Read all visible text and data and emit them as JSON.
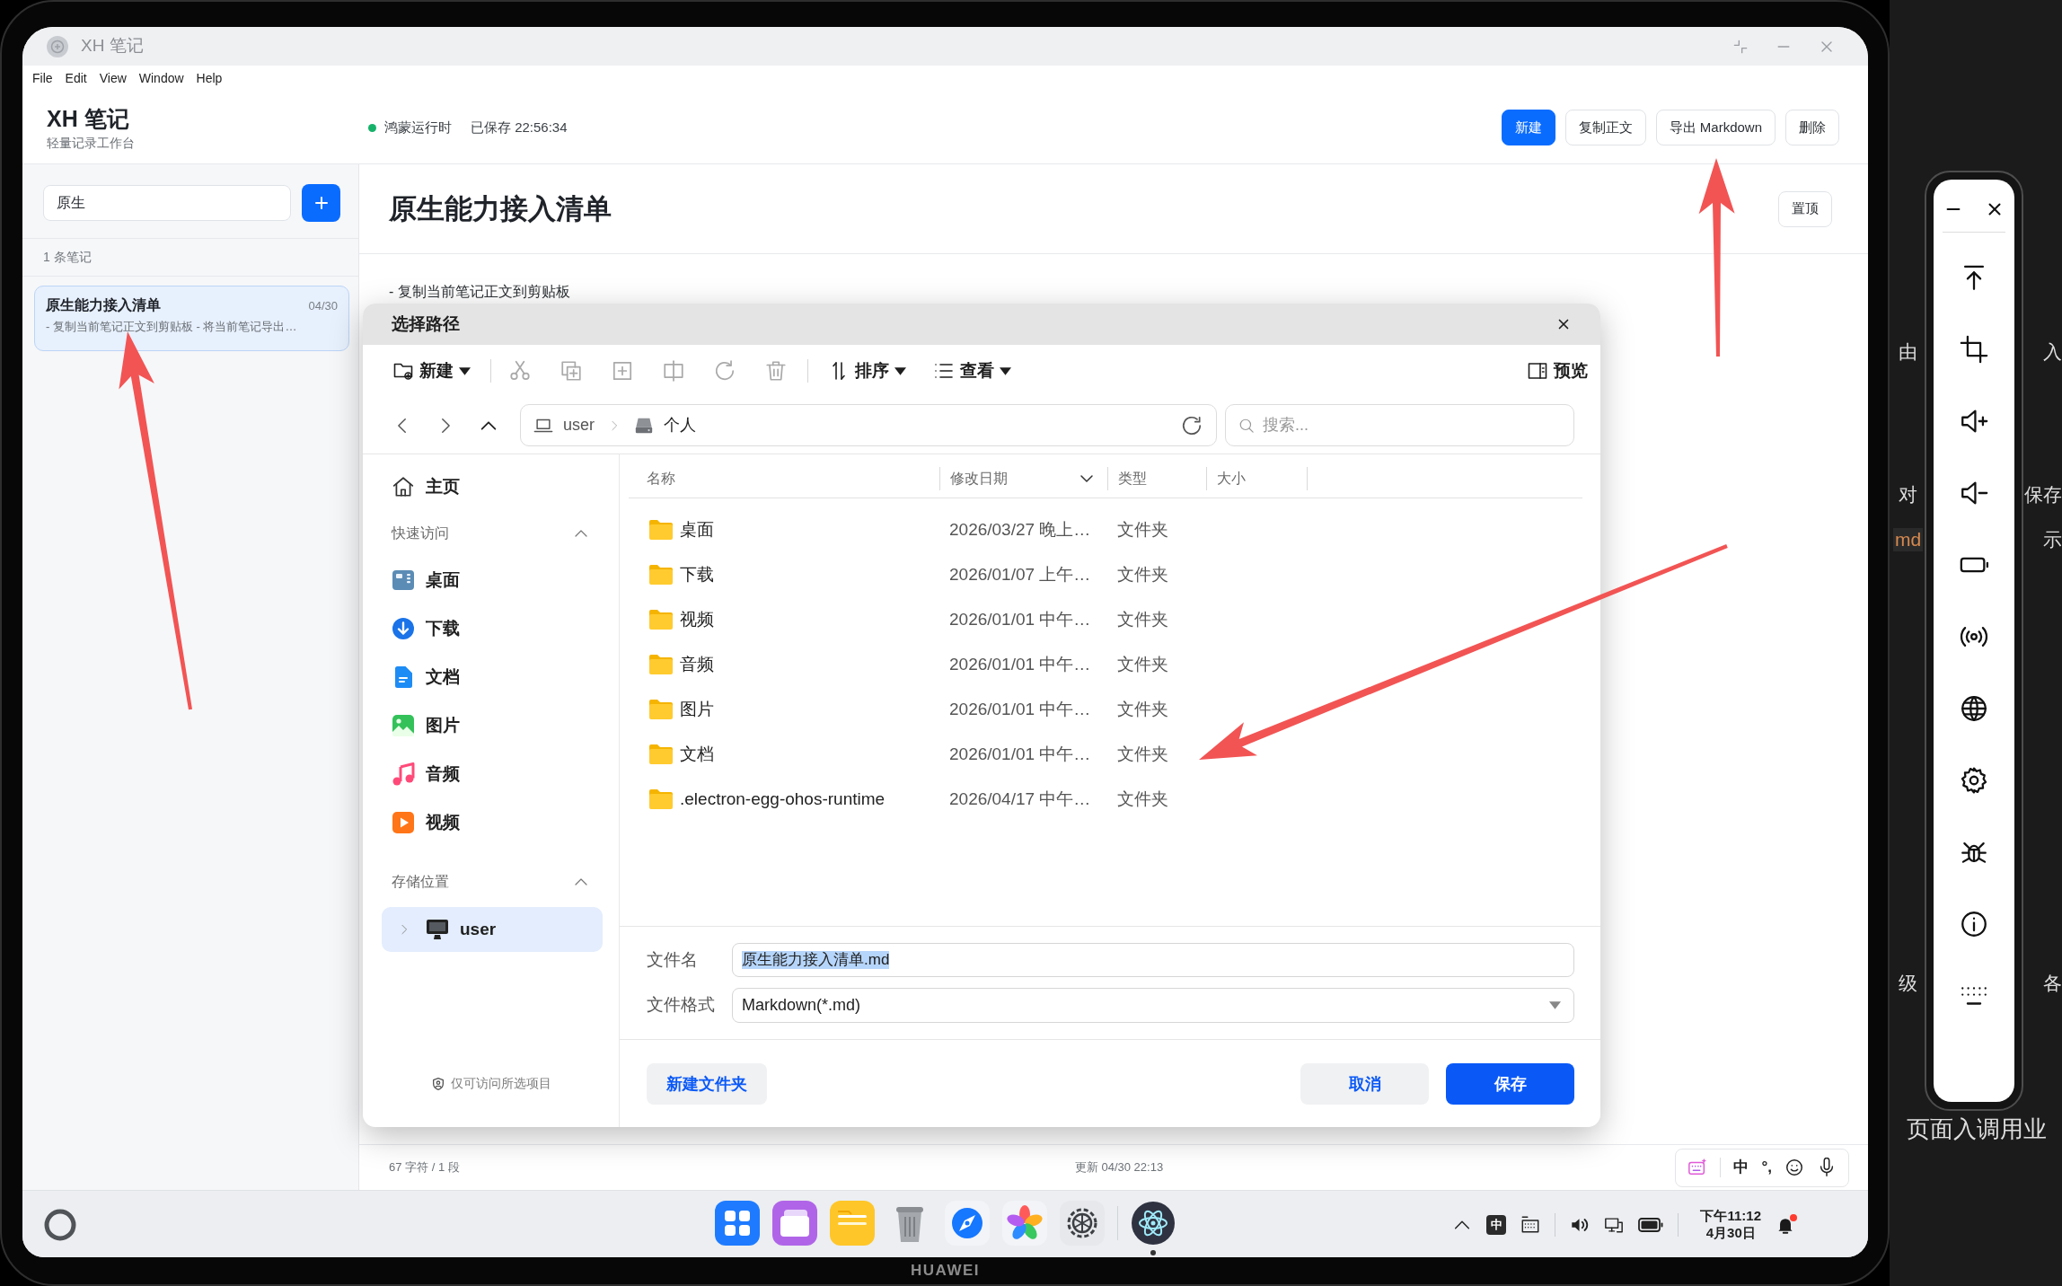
{
  "window": {
    "title": "XH 笔记",
    "menu": [
      "File",
      "Edit",
      "View",
      "Window",
      "Help"
    ]
  },
  "header": {
    "app_name": "XH 笔记",
    "subtitle": "轻量记录工作台",
    "runtime": {
      "label": "鸿蒙运行时",
      "online": true
    },
    "saved": "已保存 22:56:34",
    "actions": [
      {
        "label": "新建",
        "kind": "primary"
      },
      {
        "label": "复制正文",
        "kind": "plain"
      },
      {
        "label": "导出 Markdown",
        "kind": "plain"
      },
      {
        "label": "删除",
        "kind": "plain"
      }
    ]
  },
  "sidebar": {
    "search": {
      "value": "原生"
    },
    "count": "1 条笔记",
    "notes": [
      {
        "title": "原生能力接入清单",
        "date": "04/30",
        "excerpt": "- 复制当前笔记正文到剪贴板 - 将当前笔记导出…",
        "selected": true
      }
    ]
  },
  "editor": {
    "title": "原生能力接入清单",
    "pin": "置顶",
    "lines": [
      "- 复制当前笔记正文到剪贴板"
    ],
    "stats": "67 字符 / 1 段",
    "updated": "更新 04/30 22:13",
    "ime": {
      "language": "中",
      "punctuation": "°,"
    }
  },
  "dialog": {
    "title": "选择路径",
    "toolbar": {
      "new": "新建",
      "tools": [
        {
          "kind": "cut",
          "disabled": true
        },
        {
          "kind": "copy",
          "disabled": true
        },
        {
          "kind": "paste",
          "disabled": true
        },
        {
          "kind": "split",
          "disabled": true
        },
        {
          "kind": "rotate",
          "disabled": true
        },
        {
          "kind": "trash",
          "disabled": true
        }
      ],
      "sort": "排序",
      "view": "查看",
      "preview": "预览"
    },
    "address": [
      {
        "kind": "computer",
        "label": "user"
      },
      {
        "kind": "drive",
        "label": "个人"
      }
    ],
    "search": {
      "placeholder": "搜索..."
    },
    "nav": {
      "home": {
        "label": "主页",
        "selected": false
      },
      "sections": [
        {
          "title": "快速访问",
          "expanded": true,
          "items": [
            {
              "kind": "desktop",
              "label": "桌面",
              "selected": false
            },
            {
              "kind": "download",
              "label": "下载",
              "selected": false
            },
            {
              "kind": "docs",
              "label": "文档",
              "selected": false
            },
            {
              "kind": "pictures",
              "label": "图片",
              "selected": false
            },
            {
              "kind": "music",
              "label": "音频",
              "selected": false
            },
            {
              "kind": "video",
              "label": "视频",
              "selected": false
            }
          ]
        },
        {
          "title": "存储位置",
          "expanded": true,
          "items": [
            {
              "kind": "computer",
              "label": "user",
              "selected": true,
              "expanded": false
            }
          ]
        }
      ],
      "note": "仅可访问所选项目"
    },
    "columns": [
      {
        "label": "名称",
        "sorted": false
      },
      {
        "label": "修改日期",
        "sorted": true
      },
      {
        "label": "类型",
        "sorted": false
      },
      {
        "label": "大小",
        "sorted": false
      }
    ],
    "rows": [
      {
        "name": "桌面",
        "modified": "2026/03/27 晚上…",
        "type": "文件夹"
      },
      {
        "name": "下载",
        "modified": "2026/01/07 上午…",
        "type": "文件夹"
      },
      {
        "name": "视频",
        "modified": "2026/01/01 中午…",
        "type": "文件夹"
      },
      {
        "name": "音频",
        "modified": "2026/01/01 中午…",
        "type": "文件夹"
      },
      {
        "name": "图片",
        "modified": "2026/01/01 中午…",
        "type": "文件夹"
      },
      {
        "name": "文档",
        "modified": "2026/01/01 中午…",
        "type": "文件夹"
      },
      {
        "name": ".electron-egg-ohos-runtime",
        "modified": "2026/04/17 中午…",
        "type": "文件夹"
      }
    ],
    "filename": {
      "label": "文件名",
      "value": "原生能力接入清单.md",
      "highlighted": true
    },
    "format": {
      "label": "文件格式",
      "value": "Markdown(*.md)"
    },
    "buttons": [
      {
        "label": "新建文件夹",
        "kind": "tonal"
      },
      {
        "label": "取消",
        "kind": "tonal"
      },
      {
        "label": "保存",
        "kind": "primary"
      }
    ]
  },
  "taskbar": {
    "dock": [
      {
        "kind": "launcher",
        "running": false
      },
      {
        "kind": "multitask",
        "running": false
      },
      {
        "kind": "files",
        "running": false
      },
      {
        "kind": "trash",
        "running": false
      },
      {
        "kind": "browser",
        "running": false
      },
      {
        "kind": "gallery",
        "running": false
      },
      {
        "kind": "settings",
        "running": false
      },
      {
        "kind": "electron",
        "running": true
      }
    ],
    "ime": "中",
    "time": "下午11:12",
    "date": "4月30日",
    "notification": true
  },
  "device": {
    "brand": "HUAWEI"
  },
  "backdrop": {
    "rows": [
      {
        "left": "由",
        "right": "入",
        "code": false
      },
      {
        "left": "对",
        "right": "保存",
        "code": false
      },
      {
        "left": "md",
        "right": "示",
        "code": true
      },
      {
        "left": "级",
        "right": "各",
        "code": false
      }
    ],
    "footer": "页面入调用业"
  }
}
